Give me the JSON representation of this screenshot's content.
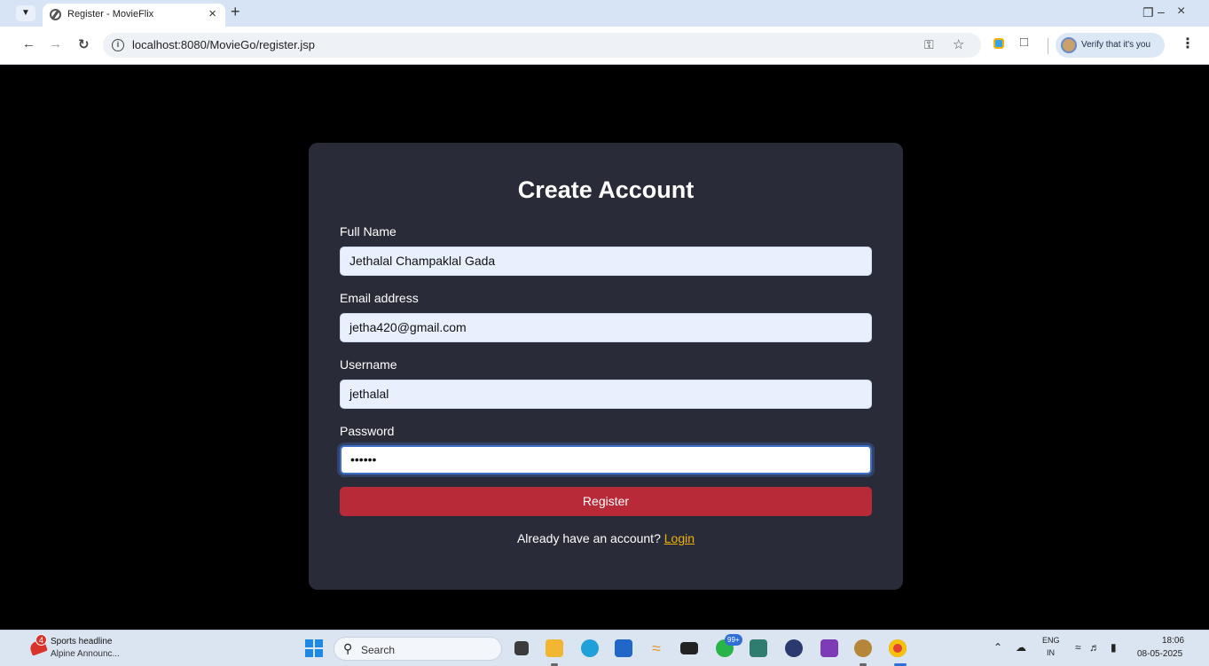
{
  "browser": {
    "tab_title": "Register - MovieFlix",
    "url": "localhost:8080/MovieGo/register.jsp",
    "verify_label": "Verify that it's you"
  },
  "form": {
    "title": "Create Account",
    "fields": [
      {
        "label": "Full Name",
        "value": "Jethalal Champaklal Gada"
      },
      {
        "label": "Email address",
        "value": "jetha420@gmail.com"
      },
      {
        "label": "Username",
        "value": "jethalal"
      },
      {
        "label": "Password",
        "value": "••••••"
      }
    ],
    "submit_label": "Register",
    "login_prompt": "Already have an account?",
    "login_link": "Login"
  },
  "taskbar": {
    "news_badge": "4",
    "news_title": "Sports headline",
    "news_subtitle": "Alpine Announc...",
    "search_placeholder": "Search",
    "whatsapp_badge": "99+",
    "lang_top": "ENG",
    "lang_bottom": "IN",
    "time": "18:06",
    "date": "08-05-2025"
  },
  "colors": {
    "page_bg": "#000000",
    "card_bg": "#2a2b38",
    "input_bg": "#e8f0fe",
    "register_button": "#b82a38",
    "login_link": "#f0b400"
  }
}
